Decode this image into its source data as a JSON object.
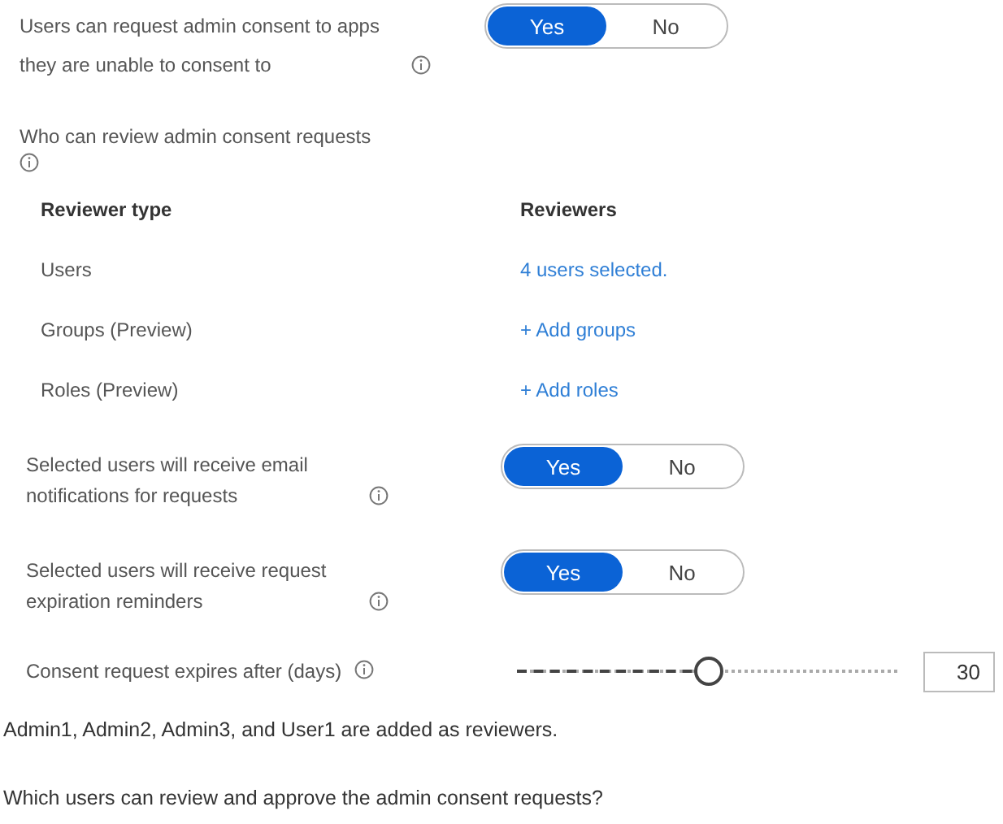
{
  "settings": [
    {
      "kind": "toggle",
      "label": "Users can request admin consent to apps they are unable to consent to",
      "options": [
        {
          "label": "Yes",
          "selected": true
        },
        {
          "label": "No",
          "selected": false
        }
      ]
    },
    {
      "kind": "reviewers",
      "label": "Who can review admin consent requests",
      "columns": [
        "Reviewer type",
        "Reviewers"
      ],
      "rows": [
        {
          "type": "Users",
          "reviewers": "4 users selected."
        },
        {
          "type": "Groups (Preview)",
          "reviewers": "+ Add groups"
        },
        {
          "type": "Roles (Preview)",
          "reviewers": "+ Add roles"
        }
      ]
    },
    {
      "kind": "toggle",
      "label": "Selected users will receive email notifications for requests",
      "options": [
        {
          "label": "Yes",
          "selected": true
        },
        {
          "label": "No",
          "selected": false
        }
      ]
    },
    {
      "kind": "toggle",
      "label": "Selected users will receive request expiration reminders",
      "options": [
        {
          "label": "Yes",
          "selected": true
        },
        {
          "label": "No",
          "selected": false
        }
      ]
    },
    {
      "kind": "slider",
      "label": "Consent request expires after (days)",
      "level": 0.5,
      "value": "30"
    }
  ],
  "notes": [
    "Admin1, Admin2, Admin3, and User1 are added as reviewers.",
    "Which users can review and approve the admin consent requests?"
  ]
}
